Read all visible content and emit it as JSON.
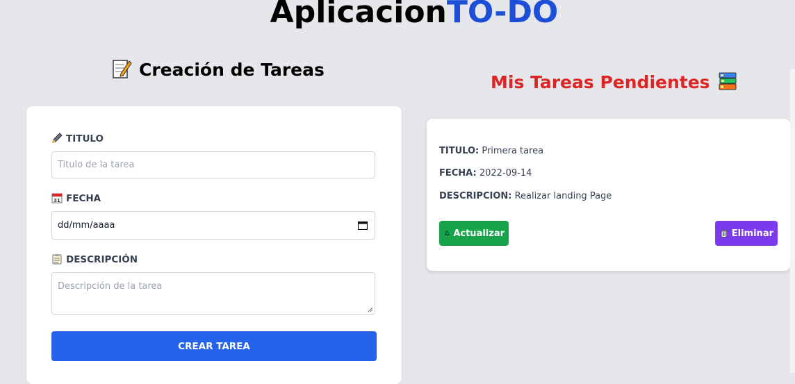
{
  "header": {
    "title_main": "Aplicacion",
    "title_accent": "TO-DO",
    "accent_color": "#1d4ed8"
  },
  "form": {
    "heading": "Creación de Tareas",
    "heading_icon": "memo-icon",
    "title_label": "TITULO",
    "title_icon": "pencil-icon",
    "title_placeholder": "Titulo de la tarea",
    "date_label": "FECHA",
    "date_icon": "calendar-icon",
    "date_value": "dd/mm/aaaa",
    "description_label": "DESCRIPCIÓN",
    "description_icon": "clipboard-icon",
    "description_placeholder": "Descripción de la tarea",
    "submit_label": "CREAR TAREA",
    "submit_color": "#2563eb"
  },
  "tasks": {
    "heading": "Mis Tareas Pendientes",
    "heading_icon": "books-icon",
    "heading_color": "#dc2626",
    "items": [
      {
        "title_label": "TITULO:",
        "title": "Primera tarea",
        "date_label": "FECHA:",
        "date": "2022-09-14",
        "description_label": "DESCRIPCION:",
        "description": "Realizar landing Page",
        "update_label": "Actualizar",
        "update_icon": "recycle-icon",
        "update_color": "#16a34a",
        "delete_label": "Eliminar",
        "delete_icon": "trash-icon",
        "delete_color": "#7c3aed"
      }
    ]
  }
}
